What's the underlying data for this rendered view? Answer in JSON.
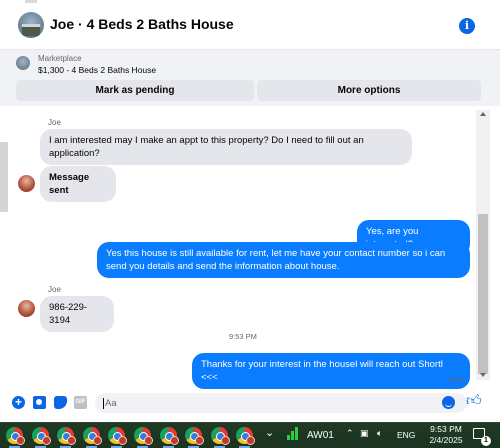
{
  "header": {
    "title": "Joe · 4 Beds 2 Baths House",
    "info_icon": "i"
  },
  "marketplace": {
    "label": "Marketplace",
    "listing": "$1,300 - 4 Beds 2 Baths House",
    "mark_pending": "Mark as pending",
    "more_options": "More options"
  },
  "messages": {
    "sender1": "Joe",
    "m1": "I am interested may I make an appt to this property? Do I need to fill out an application?",
    "m2": "Message sent",
    "m3": "Yes, are you interested?",
    "m4": "Yes this house is still available for rent, let me have your contact number so i can send you details and send the information about house.",
    "sender2": "Joe",
    "m5": "986-229-3194",
    "timestamp": "9:53 PM",
    "m6": "Thanks for your interest in the housel will reach out Shortl <<<",
    "status": "Sent"
  },
  "composer": {
    "placeholder": "Aa",
    "gif": "GIF"
  },
  "taskbar": {
    "stock": "AW01",
    "lang": "ENG",
    "time": "9:53 PM",
    "date": "2/4/2025",
    "notifications": "1",
    "app_icon_count": 10
  },
  "colors": {
    "accent": "#0a7cff",
    "bubble_in": "#e4e6eb",
    "taskbar": "#1f3a24"
  }
}
